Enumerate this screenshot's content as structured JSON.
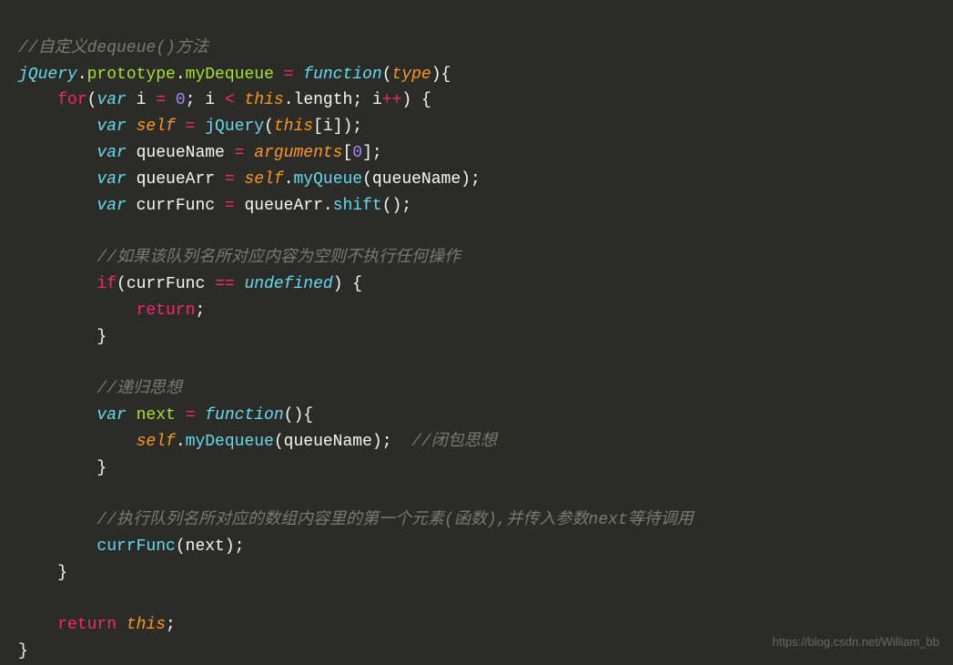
{
  "code": {
    "line1_comment": "//自定义dequeue()方法",
    "line2_jquery": "jQuery",
    "line2_dot1": ".",
    "line2_prototype": "prototype",
    "line2_dot2": ".",
    "line2_mydequeue": "myDequeue",
    "line2_eq": " = ",
    "line2_function": "function",
    "line2_paren1": "(",
    "line2_type": "type",
    "line2_paren2": "){",
    "line3_indent": "    ",
    "line3_for": "for",
    "line3_paren1": "(",
    "line3_var": "var",
    "line3_i": " i ",
    "line3_eq": "= ",
    "line3_zero": "0",
    "line3_semi1": "; i ",
    "line3_lt": "< ",
    "line3_this": "this",
    "line3_dot": ".",
    "line3_length": "length",
    "line3_semi2": "; i",
    "line3_inc": "++",
    "line3_paren2": ") {",
    "line4_indent": "        ",
    "line4_var": "var",
    "line4_self": " self",
    "line4_eq": " = ",
    "line4_jquery": "jQuery",
    "line4_paren1": "(",
    "line4_this": "this",
    "line4_bracket": "[i]);",
    "line5_indent": "        ",
    "line5_var": "var",
    "line5_qname": " queueName ",
    "line5_eq": "= ",
    "line5_args": "arguments",
    "line5_bracket1": "[",
    "line5_zero": "0",
    "line5_bracket2": "];",
    "line6_indent": "        ",
    "line6_var": "var",
    "line6_qarr": " queueArr ",
    "line6_eq": "= ",
    "line6_self": "self",
    "line6_dot": ".",
    "line6_myqueue": "myQueue",
    "line6_paren": "(queueName);",
    "line7_indent": "        ",
    "line7_var": "var",
    "line7_curr": " currFunc ",
    "line7_eq": "= ",
    "line7_qarr": "queueArr.",
    "line7_shift": "shift",
    "line7_paren": "();",
    "line8_blank": "",
    "line9_indent": "        ",
    "line9_comment": "//如果该队列名所对应内容为空则不执行任何操作",
    "line10_indent": "        ",
    "line10_if": "if",
    "line10_paren1": "(currFunc ",
    "line10_eq": "== ",
    "line10_undef": "undefined",
    "line10_paren2": ") {",
    "line11_indent": "            ",
    "line11_return": "return",
    "line11_semi": ";",
    "line12_indent": "        ",
    "line12_brace": "}",
    "line13_blank": "",
    "line14_indent": "        ",
    "line14_comment": "//递归思想",
    "line15_indent": "        ",
    "line15_var": "var",
    "line15_next": " next",
    "line15_eq": " = ",
    "line15_function": "function",
    "line15_paren": "(){",
    "line16_indent": "            ",
    "line16_self": "self",
    "line16_dot": ".",
    "line16_mydeq": "myDequeue",
    "line16_paren": "(queueName);  ",
    "line16_comment": "//闭包思想",
    "line17_indent": "        ",
    "line17_brace": "}",
    "line18_blank": "",
    "line19_indent": "        ",
    "line19_comment": "//执行队列名所对应的数组内容里的第一个元素(函数),并传入参数next等待调用",
    "line20_indent": "        ",
    "line20_curr": "currFunc",
    "line20_paren": "(next);",
    "line21_indent": "    ",
    "line21_brace": "}",
    "line22_blank": "",
    "line23_indent": "    ",
    "line23_return": "return",
    "line23_this": " this",
    "line23_semi": ";",
    "line24_brace": "}"
  },
  "watermark": "https://blog.csdn.net/William_bb"
}
